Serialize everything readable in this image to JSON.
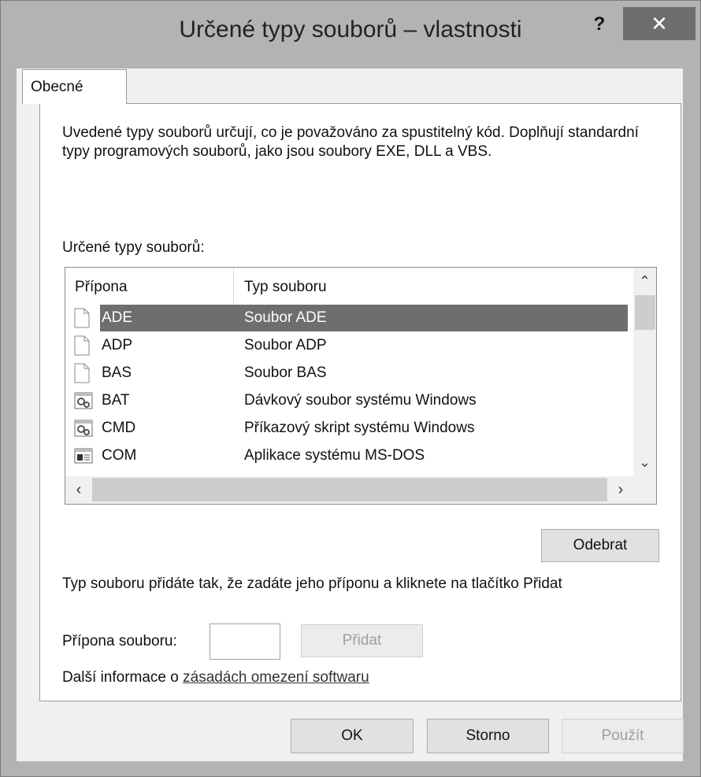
{
  "window": {
    "title": "Určené typy souborů – vlastnosti",
    "help_label": "?",
    "close_label": "✕"
  },
  "tabs": [
    {
      "label": "Obecné",
      "active": true
    }
  ],
  "general": {
    "description": "Uvedené typy souborů určují, co je považováno za spustitelný kód. Doplňují standardní typy programových souborů, jako jsou soubory EXE, DLL a VBS.",
    "list_label": "Určené typy souborů:",
    "columns": [
      "Přípona",
      "Typ souboru"
    ],
    "rows": [
      {
        "ext": "ADE",
        "type": "Soubor ADE",
        "icon": "blank-file-icon",
        "selected": true
      },
      {
        "ext": "ADP",
        "type": "Soubor ADP",
        "icon": "blank-file-icon",
        "selected": false
      },
      {
        "ext": "BAS",
        "type": "Soubor BAS",
        "icon": "blank-file-icon",
        "selected": false
      },
      {
        "ext": "BAT",
        "type": "Dávkový soubor systému Windows",
        "icon": "gear-script-icon",
        "selected": false
      },
      {
        "ext": "CMD",
        "type": "Příkazový skript systému Windows",
        "icon": "gear-script-icon",
        "selected": false
      },
      {
        "ext": "COM",
        "type": "Aplikace systému MS-DOS",
        "icon": "dos-app-icon",
        "selected": false
      }
    ],
    "remove_button": "Odebrat",
    "add_description": "Typ souboru přidáte tak, že zadáte jeho příponu a kliknete na tlačítko Přidat",
    "extension_label": "Přípona souboru:",
    "extension_value": "",
    "add_button": "Přidat",
    "info_prefix": "Další informace o ",
    "info_link": "zásadách omezení softwaru"
  },
  "footer": {
    "ok": "OK",
    "cancel": "Storno",
    "apply": "Použít"
  }
}
